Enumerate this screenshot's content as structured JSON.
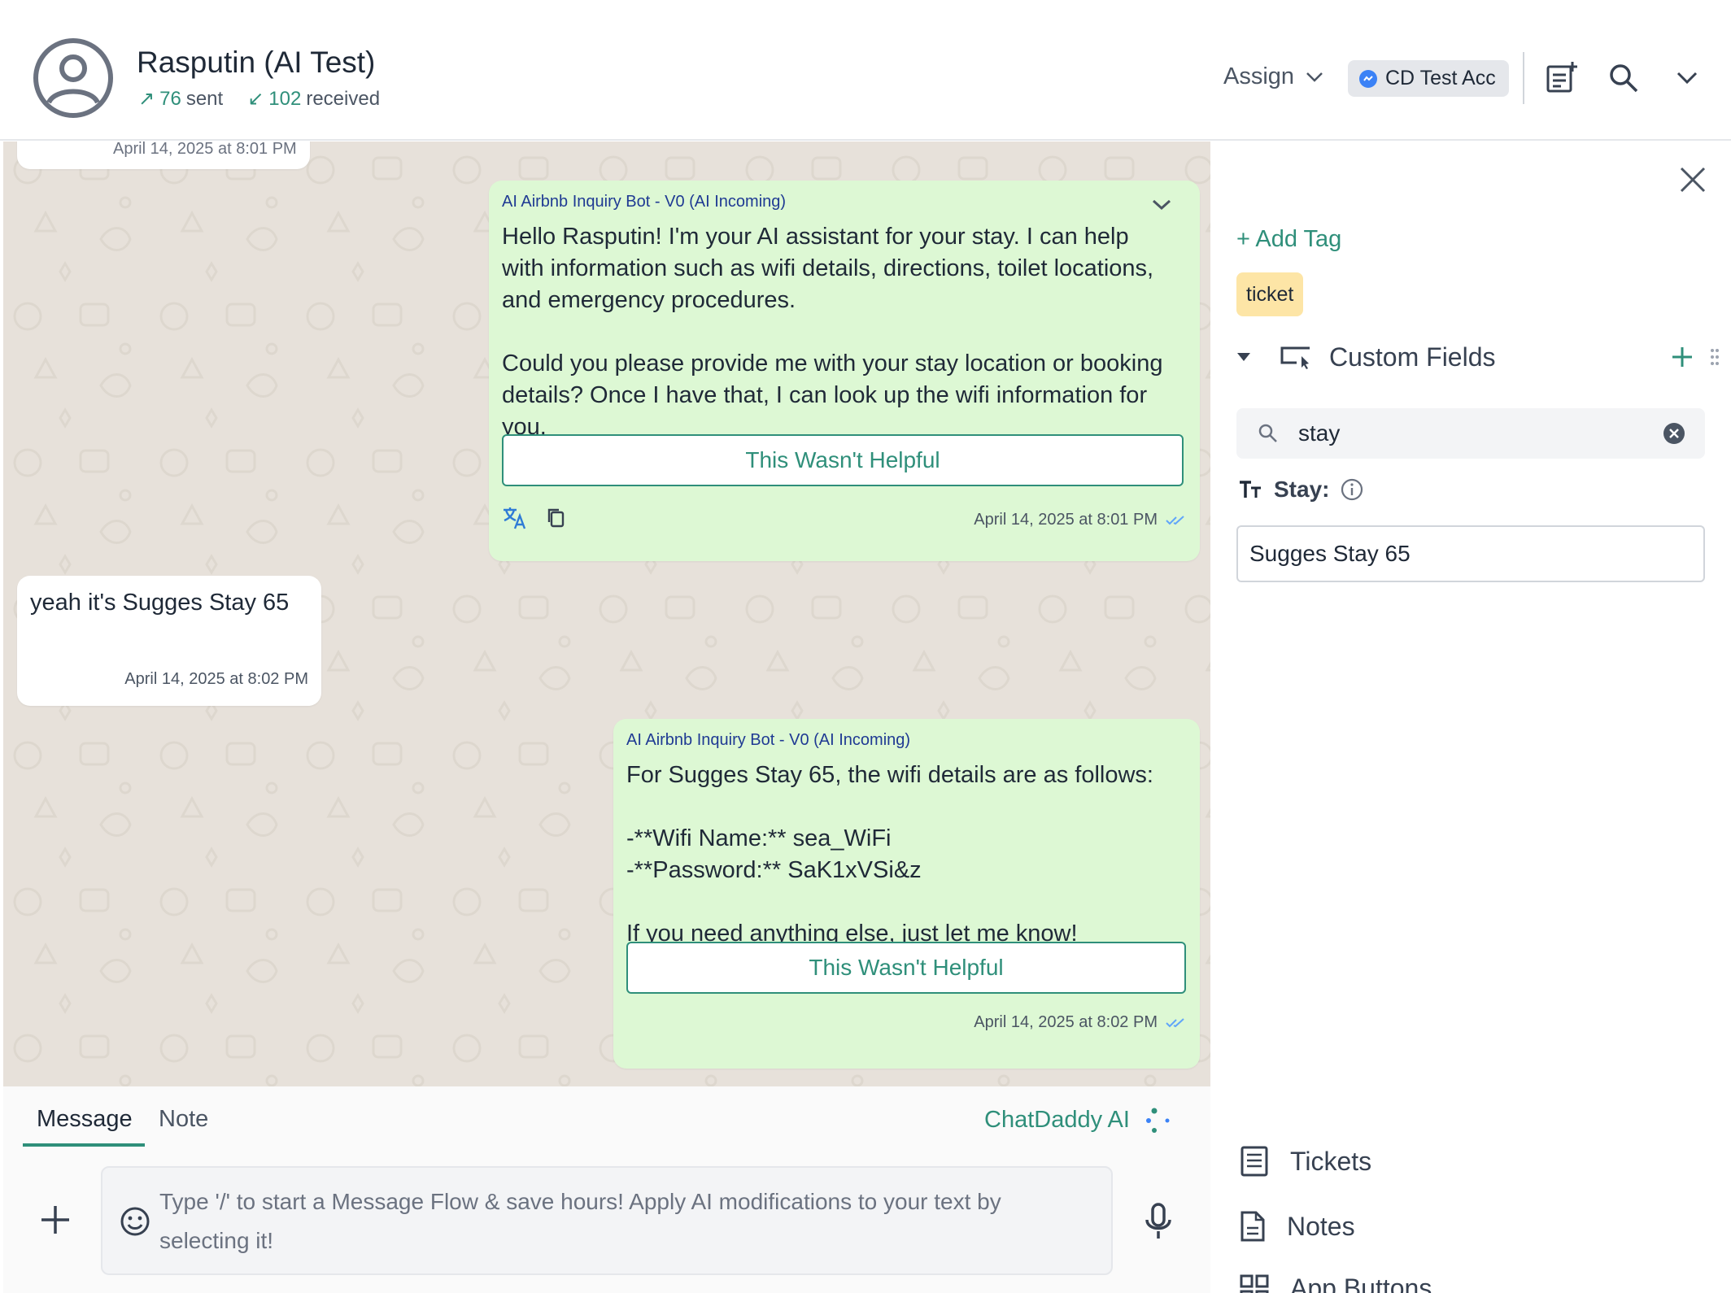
{
  "header": {
    "contact_name": "Rasputin (AI Test)",
    "sent_count": "76",
    "sent_label": "sent",
    "received_count": "102",
    "received_label": "received",
    "assign_label": "Assign",
    "account_label": "CD Test Acc"
  },
  "chat": {
    "partial_top_timestamp": "April 14, 2025 at 8:01 PM",
    "messages": [
      {
        "sender": "AI Airbnb Inquiry Bot - V0 (AI Incoming)",
        "text": "Hello Rasputin! I'm your AI assistant for your stay. I can help with information such as wifi details, directions, toilet locations, and emergency procedures.\n\nCould you please provide me with your stay location or booking details? Once I have that, I can look up the wifi information for you.",
        "helpful_label": "This Wasn't Helpful",
        "timestamp": "April 14, 2025 at 8:01 PM"
      },
      {
        "text": "yeah it's Sugges Stay 65",
        "timestamp": "April 14, 2025 at 8:02 PM"
      },
      {
        "sender": "AI Airbnb Inquiry Bot - V0 (AI Incoming)",
        "text": "For Sugges Stay 65, the wifi details are as follows:\n\n-**Wifi Name:** sea_WiFi\n-**Password:** SaK1xVSi&z\n\nIf you need anything else, just let me know!",
        "helpful_label": "This Wasn't Helpful",
        "timestamp": "April 14, 2025 at 8:02 PM"
      }
    ]
  },
  "composer": {
    "tab_message": "Message",
    "tab_note": "Note",
    "ai_label": "ChatDaddy AI",
    "placeholder": "Type '/' to start a Message Flow & save hours! Apply AI modifications to your text by selecting it!"
  },
  "panel": {
    "add_tag_label": "+ Add Tag",
    "tags": [
      "ticket"
    ],
    "custom_fields_title": "Custom Fields",
    "search_value": "stay",
    "field_label": "Stay:",
    "field_value": "Sugges Stay 65",
    "links": [
      "Tickets",
      "Notes",
      "App Buttons"
    ]
  },
  "colors": {
    "accent": "#2f8f7a",
    "outgoing_bubble": "#ddf8d4",
    "chat_background": "#e7e1da",
    "tag": "#fde5a6",
    "bot_name": "#1f3a93"
  }
}
